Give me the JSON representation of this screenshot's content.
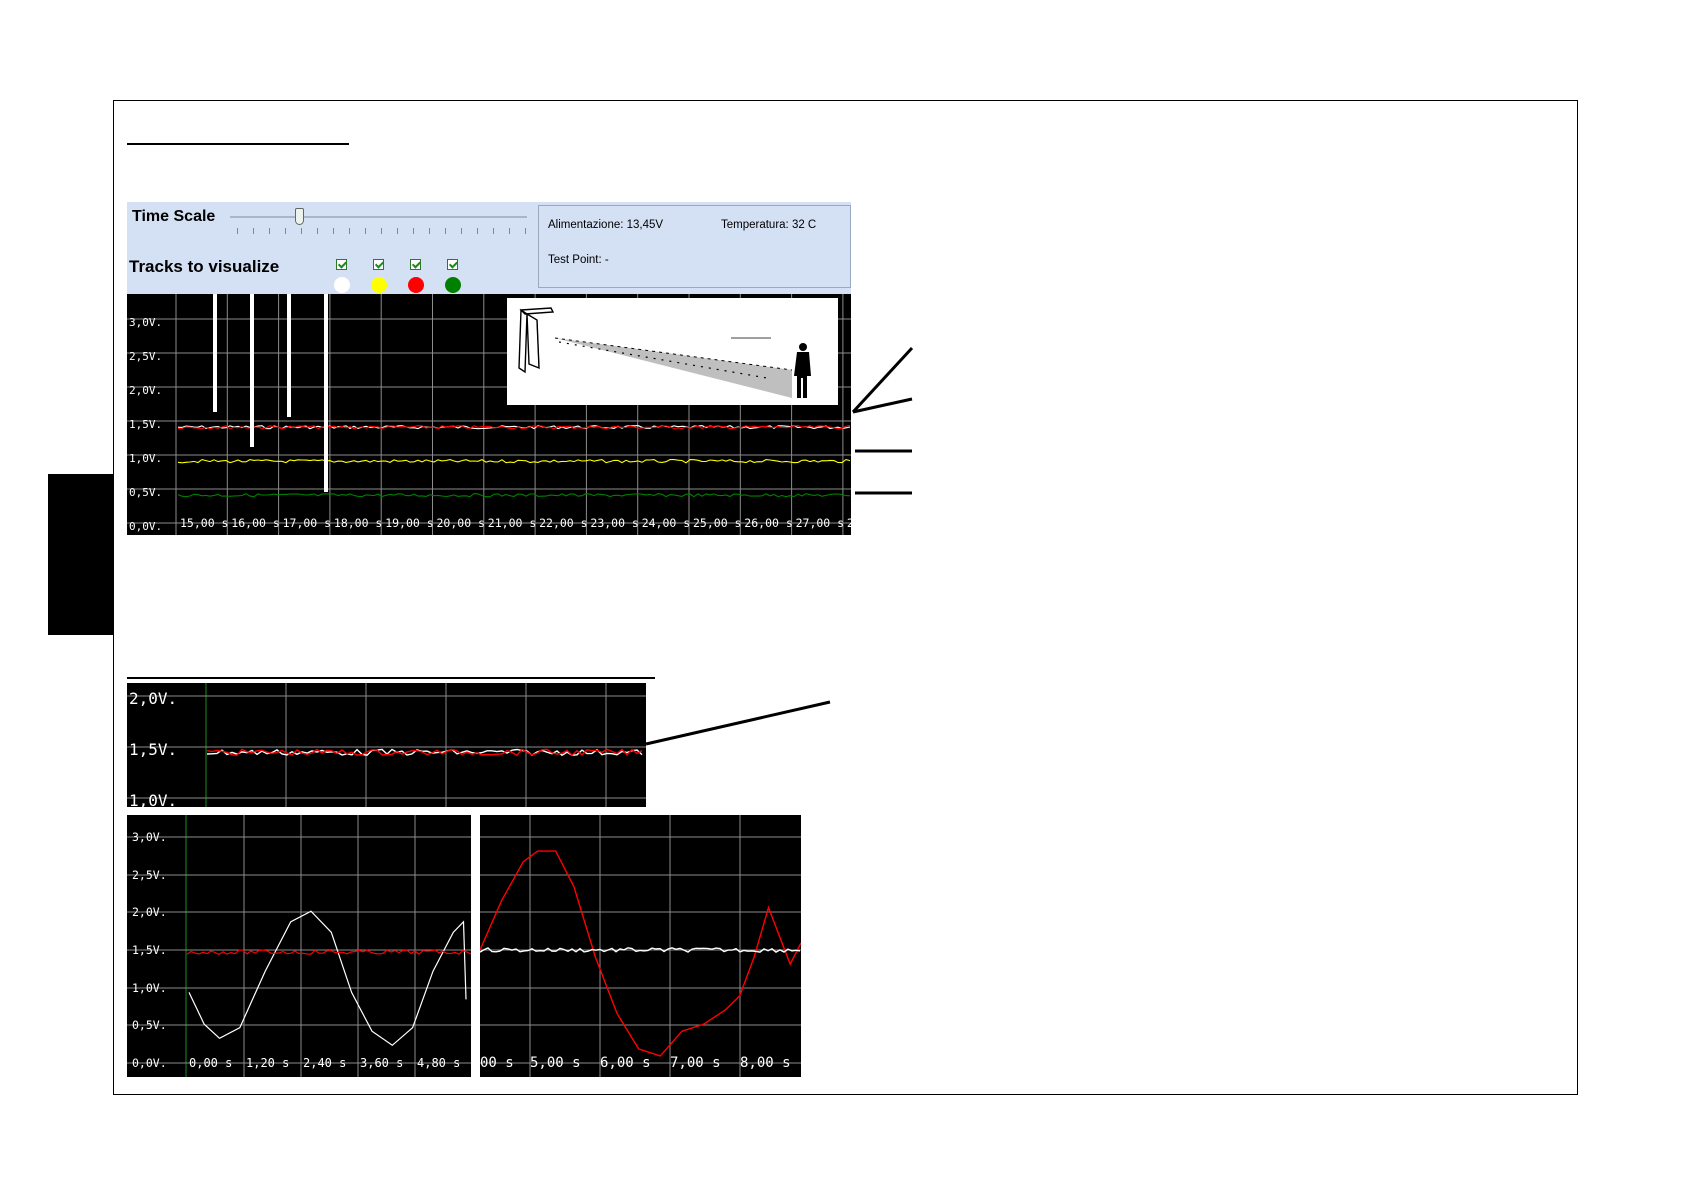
{
  "time_scale_label": "Time Scale",
  "tracks_label": "Tracks to visualize",
  "tracks": [
    {
      "checked": true,
      "color": "#ffffff"
    },
    {
      "checked": true,
      "color": "#ffff00"
    },
    {
      "checked": true,
      "color": "#ff0000"
    },
    {
      "checked": true,
      "color": "#008000"
    }
  ],
  "status": {
    "supply": "Alimentazione: 13,45V",
    "temperature": "Temperatura: 32 C",
    "test_point": "Test Point: -"
  },
  "colors": {
    "chart_bg": "#000000",
    "grid": "#8c8c8c",
    "panel_bg": "#d4e0f4"
  },
  "chart_data": [
    {
      "type": "line",
      "y_tick_labels": [
        "3,0V.",
        "2,5V.",
        "2,0V.",
        "1,5V.",
        "1,0V.",
        "0,5V.",
        "0,0V."
      ],
      "x_tick_labels": [
        "15,00 s",
        "16,00 s",
        "17,00 s",
        "18,00 s",
        "19,00 s",
        "20,00 s",
        "21,00 s",
        "22,00 s",
        "23,00 s",
        "24,00 s",
        "25,00 s",
        "26,00 s",
        "27,00 s",
        "2"
      ],
      "ylim": [
        0,
        3.3
      ],
      "series": [
        {
          "color": "#ffffff",
          "level": 1.55
        },
        {
          "color": "#ff0000",
          "level": 1.55
        },
        {
          "color": "#ffff00",
          "level": 1.0
        },
        {
          "color": "#008000",
          "level": 0.45
        }
      ]
    },
    {
      "type": "line",
      "y_tick_labels": [
        "2,0V.",
        "1,5V.",
        "1,0V."
      ],
      "ylim": [
        0.95,
        2.1
      ],
      "series": [
        {
          "color": "#ffffff",
          "level": 1.5
        },
        {
          "color": "#ff0000",
          "level": 1.5
        }
      ]
    },
    {
      "type": "line",
      "y_tick_labels": [
        "3,0V.",
        "2,5V.",
        "2,0V.",
        "1,5V.",
        "1,0V.",
        "0,5V.",
        "0,0V."
      ],
      "x_tick_labels": [
        "0,00 s",
        "1,20 s",
        "2,40 s",
        "3,60 s",
        "4,80 s"
      ],
      "ylim": [
        0,
        3.2
      ],
      "series": [
        {
          "color": "#ffffff",
          "x": [
            0,
            0.3,
            0.6,
            1.0,
            1.5,
            2.0,
            2.4,
            2.8,
            3.2,
            3.6,
            4.0,
            4.4,
            4.8,
            5.2,
            5.4,
            5.45
          ],
          "y": [
            1.0,
            0.55,
            0.35,
            0.5,
            1.3,
            2.0,
            2.15,
            1.85,
            1.0,
            0.45,
            0.25,
            0.5,
            1.3,
            1.85,
            2.0,
            0.9
          ]
        },
        {
          "color": "#ff0000",
          "level": 1.57
        }
      ]
    },
    {
      "type": "line",
      "x_tick_labels": [
        "00 s",
        "5,00 s",
        "6,00 s",
        "7,00 s",
        "8,00 s"
      ],
      "ylim": [
        0,
        3.2
      ],
      "series": [
        {
          "color": "#ff0000",
          "x": [
            3.9,
            4.2,
            4.5,
            4.7,
            4.95,
            5.2,
            5.5,
            5.8,
            6.1,
            6.4,
            6.7,
            7.0,
            7.3,
            7.5,
            7.7,
            7.9,
            8.2,
            8.35
          ],
          "y": [
            1.6,
            2.3,
            2.85,
            3.0,
            3.0,
            2.5,
            1.5,
            0.7,
            0.2,
            0.1,
            0.45,
            0.55,
            0.75,
            0.95,
            1.5,
            2.2,
            1.4,
            1.7
          ]
        },
        {
          "color": "#ffffff",
          "level": 1.6
        }
      ]
    }
  ]
}
